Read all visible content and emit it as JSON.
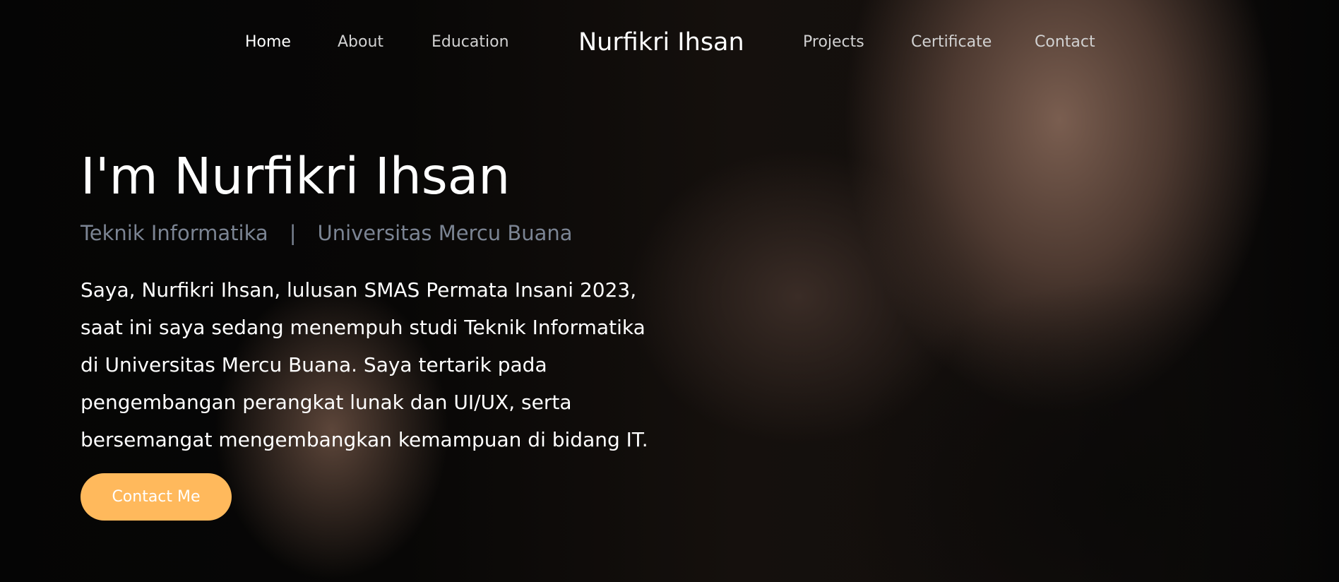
{
  "nav": {
    "left": [
      {
        "label": "Home",
        "active": true
      },
      {
        "label": "About"
      },
      {
        "label": "Education"
      }
    ],
    "brand": "Nurfikri Ihsan",
    "right": [
      {
        "label": "Projects"
      },
      {
        "label": "Certificate"
      },
      {
        "label": "Contact"
      }
    ]
  },
  "hero": {
    "title": "I'm Nurfikri Ihsan",
    "subtitle": {
      "program": "Teknik Informatika",
      "separator": "|",
      "university": "Universitas Mercu Buana"
    },
    "bio": "Saya, Nurfikri Ihsan, lulusan SMAS Permata Insani 2023, saat ini saya sedang menempuh studi Teknik Informatika di Universitas Mercu Buana. Saya tertarik pada pengembangan perangkat lunak dan UI/UX, serta bersemangat mengembangkan kemampuan di bidang IT.",
    "cta_label": "Contact Me"
  },
  "colors": {
    "accent": "#ffb95c",
    "subtitle": "#7b8493",
    "text": "#ffffff"
  }
}
